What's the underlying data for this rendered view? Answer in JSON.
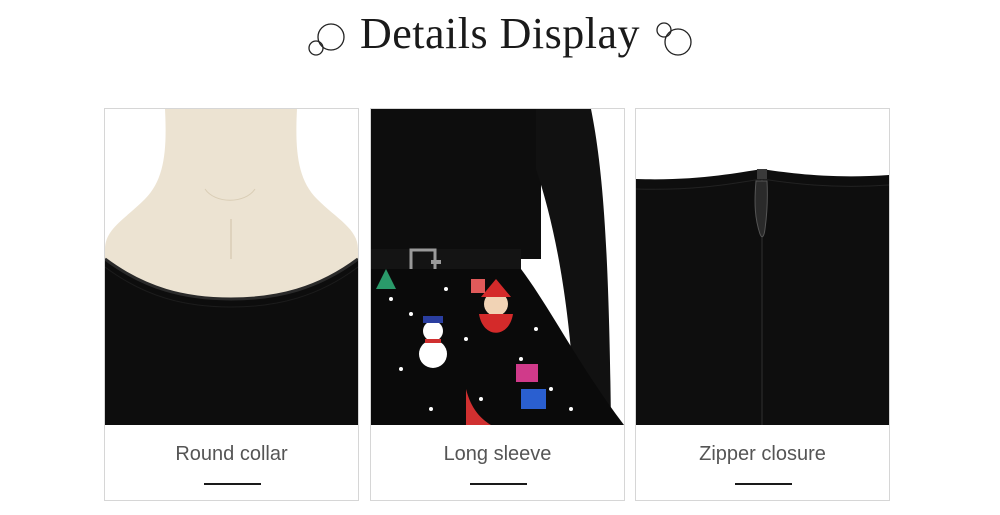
{
  "header": {
    "title": "Details Display"
  },
  "features": [
    {
      "label": "Round collar",
      "image": "mannequin-neck-black-top"
    },
    {
      "label": "Long sleeve",
      "image": "christmas-print-skirt-with-belt"
    },
    {
      "label": "Zipper closure",
      "image": "back-zipper-closeup"
    }
  ],
  "colors": {
    "fabric": "#0d0d0d",
    "mannequin": "#ece3d2",
    "caption_text": "#555555",
    "border": "#d6d6d6"
  }
}
